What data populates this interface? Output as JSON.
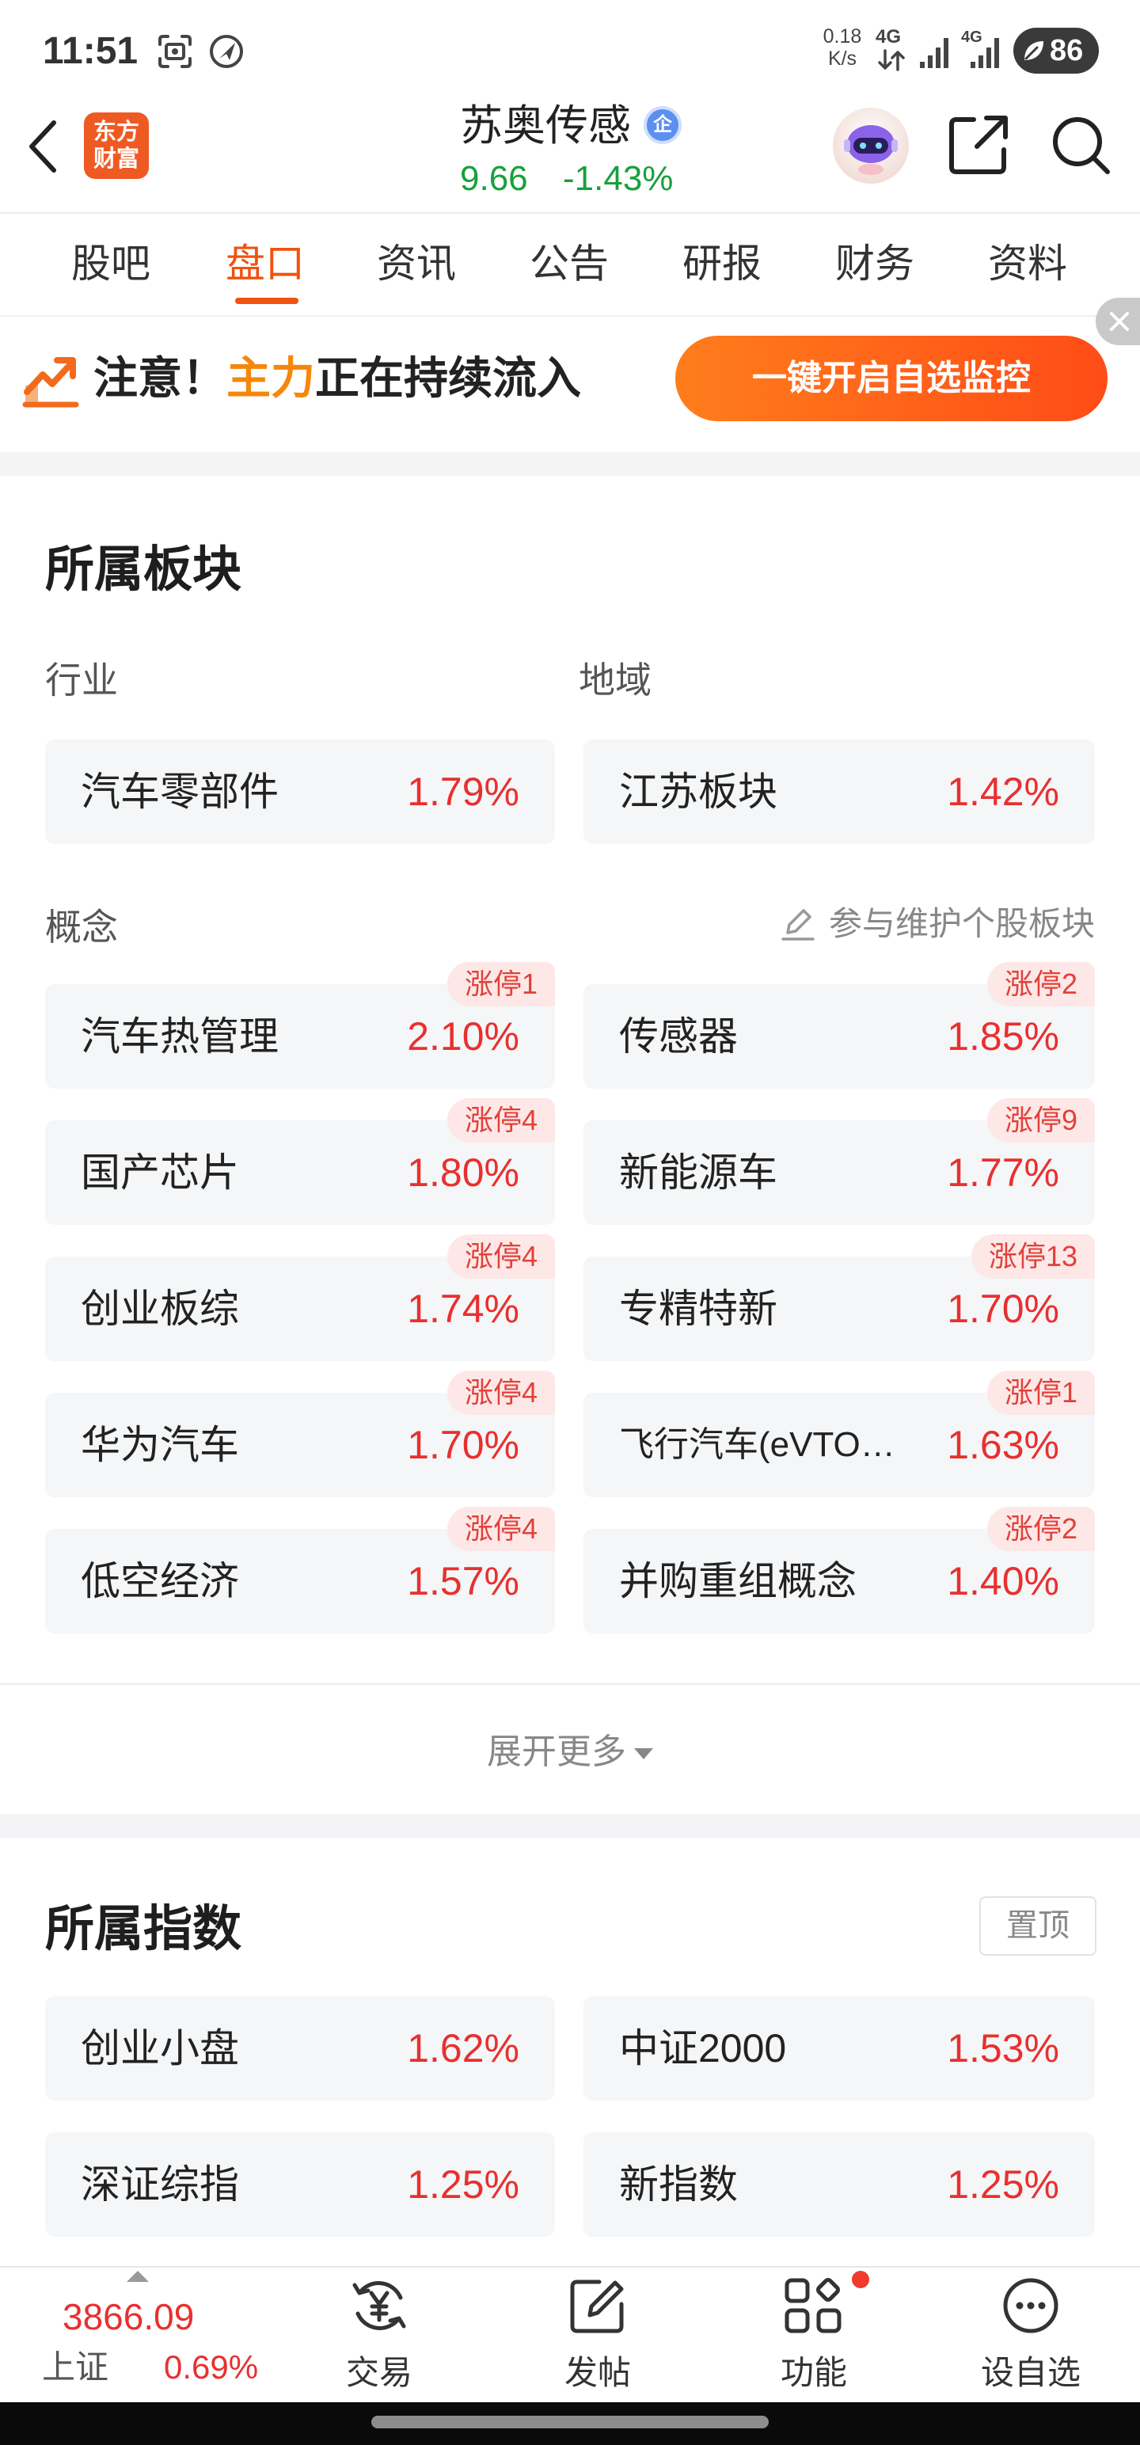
{
  "status_bar": {
    "time": "11:51",
    "net_speed": "0.18",
    "net_unit": "K/s",
    "sim1_type": "4G",
    "sim2_type": "4G",
    "battery": "86",
    "icons": [
      "screenshot-icon",
      "navigation-icon",
      "signal-icon",
      "battery-icon"
    ]
  },
  "header": {
    "back_icon": "back-arrow-icon",
    "logo_line1": "东方",
    "logo_line2": "财富",
    "stock_name": "苏奥传感",
    "badge": "企",
    "price": "9.66",
    "change_pct": "-1.43%",
    "right_icons": [
      "robot-avatar-icon",
      "share-icon",
      "search-icon"
    ]
  },
  "tabs": [
    {
      "label": "股吧",
      "active": false
    },
    {
      "label": "盘口",
      "active": true
    },
    {
      "label": "资讯",
      "active": false
    },
    {
      "label": "公告",
      "active": false
    },
    {
      "label": "研报",
      "active": false
    },
    {
      "label": "财务",
      "active": false
    },
    {
      "label": "资料",
      "active": false
    }
  ],
  "banner": {
    "text_a": "注意！",
    "text_b": "主力",
    "text_c": "正在持续流入",
    "button": "一键开启自选监控",
    "icon": "trend-up-icon"
  },
  "sectors": {
    "title": "所属板块",
    "industry_label": "行业",
    "region_label": "地域",
    "industry": {
      "name": "汽车零部件",
      "change": "1.79%"
    },
    "region": {
      "name": "江苏板块",
      "change": "1.42%"
    },
    "concept_label": "概念",
    "maintain_link": "参与维护个股板块",
    "concepts": [
      {
        "name": "汽车热管理",
        "change": "2.10%",
        "limit_up": "涨停1"
      },
      {
        "name": "传感器",
        "change": "1.85%",
        "limit_up": "涨停2"
      },
      {
        "name": "国产芯片",
        "change": "1.80%",
        "limit_up": "涨停4"
      },
      {
        "name": "新能源车",
        "change": "1.77%",
        "limit_up": "涨停9"
      },
      {
        "name": "创业板综",
        "change": "1.74%",
        "limit_up": "涨停4"
      },
      {
        "name": "专精特新",
        "change": "1.70%",
        "limit_up": "涨停13"
      },
      {
        "name": "华为汽车",
        "change": "1.70%",
        "limit_up": "涨停4"
      },
      {
        "name": "飞行汽车(eVTO…",
        "change": "1.63%",
        "limit_up": "涨停1"
      },
      {
        "name": "低空经济",
        "change": "1.57%",
        "limit_up": "涨停4"
      },
      {
        "name": "并购重组概念",
        "change": "1.40%",
        "limit_up": "涨停2"
      }
    ],
    "expand": "展开更多"
  },
  "indices": {
    "title": "所属指数",
    "pin": "置顶",
    "items": [
      {
        "name": "创业小盘",
        "change": "1.62%"
      },
      {
        "name": "中证2000",
        "change": "1.53%"
      },
      {
        "name": "深证综指",
        "change": "1.25%"
      },
      {
        "name": "新指数",
        "change": "1.25%"
      }
    ]
  },
  "bottom_nav": {
    "index_value": "3866.09",
    "index_name": "上证",
    "index_change": "0.69%",
    "items": [
      {
        "label": "交易",
        "icon": "trade-yen-icon"
      },
      {
        "label": "发帖",
        "icon": "post-edit-icon"
      },
      {
        "label": "功能",
        "icon": "functions-grid-icon",
        "has_dot": true
      },
      {
        "label": "设自选",
        "icon": "more-dots-icon"
      }
    ]
  },
  "colors": {
    "accent": "#f0520f",
    "up": "#e8302f",
    "down": "#17a03c",
    "highlight": "#f5870b",
    "cell_bg": "#f5f6f7"
  }
}
